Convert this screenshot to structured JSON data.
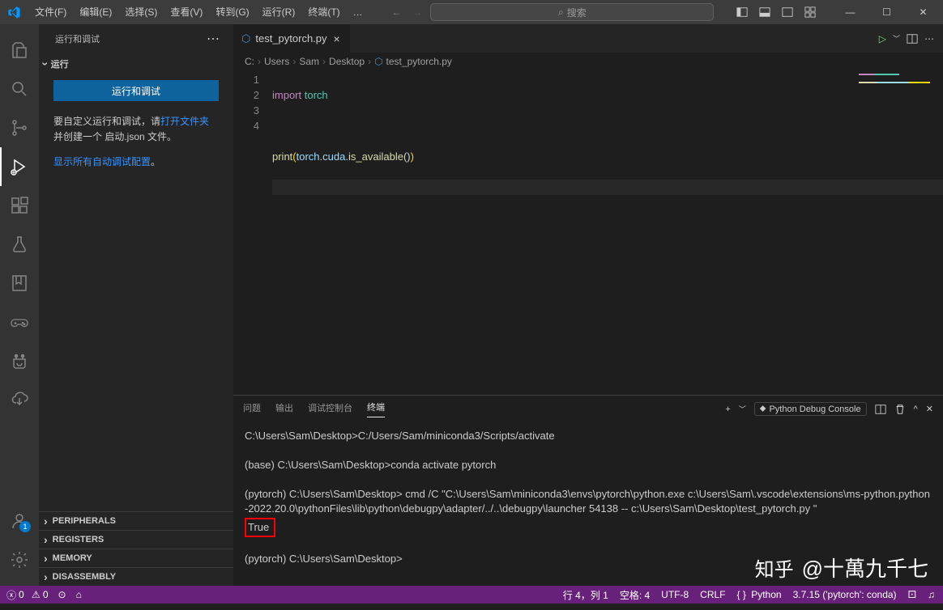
{
  "menu": {
    "file": "文件(F)",
    "edit": "编辑(E)",
    "select": "选择(S)",
    "view": "查看(V)",
    "go": "转到(G)",
    "run": "运行(R)",
    "terminal": "终端(T)",
    "more": "…"
  },
  "titlebar": {
    "search_placeholder": "搜索"
  },
  "sidebar": {
    "title": "运行和调试",
    "section_run": "运行",
    "run_debug_btn": "运行和调试",
    "hint_prefix": "要自定义运行和调试，请",
    "hint_link": "打开文件夹",
    "hint_suffix": " 并创建一个 启动.json 文件。",
    "show_configs_prefix": "显示所有自动调试配置",
    "show_configs_suffix": "。",
    "panels": {
      "peripherals": "PERIPHERALS",
      "registers": "REGISTERS",
      "memory": "MEMORY",
      "disassembly": "DISASSEMBLY"
    }
  },
  "tab": {
    "filename": "test_pytorch.py",
    "close": "×"
  },
  "breadcrumb": {
    "p0": "C:",
    "p1": "Users",
    "p2": "Sam",
    "p3": "Desktop",
    "p4": "test_pytorch.py"
  },
  "code": {
    "l1": {
      "kw": "import",
      "mod": " torch"
    },
    "l3_fn": "print",
    "l3_open": "(",
    "l3_var1": "torch",
    "l3_dot1": ".",
    "l3_var2": "cuda",
    "l3_dot2": ".",
    "l3_fn2": "is_available",
    "l3_par": "()",
    "l3_close": ")"
  },
  "lines": {
    "l1": "1",
    "l2": "2",
    "l3": "3",
    "l4": "4"
  },
  "panel": {
    "problems": "问题",
    "output": "输出",
    "debug_console": "调试控制台",
    "terminal": "终端",
    "py_debug": "Python Debug Console"
  },
  "terminal": {
    "l1": "C:\\Users\\Sam\\Desktop>C:/Users/Sam/miniconda3/Scripts/activate",
    "l2": "(base) C:\\Users\\Sam\\Desktop>conda activate pytorch",
    "l3": "(pytorch) C:\\Users\\Sam\\Desktop> cmd /C \"C:\\Users\\Sam\\miniconda3\\envs\\pytorch\\python.exe c:\\Users\\Sam\\.vscode\\extensions\\ms-python.python-2022.20.0\\pythonFiles\\lib\\python\\debugpy\\adapter/../..\\debugpy\\launcher 54138 -- c:\\Users\\Sam\\Desktop\\test_pytorch.py \"",
    "l4": "True",
    "l5": "(pytorch) C:\\Users\\Sam\\Desktop>"
  },
  "status": {
    "errors": "0",
    "warnings": "0",
    "line_col": "行 4，列 1",
    "spaces": "空格: 4",
    "encoding": "UTF-8",
    "eol": "CRLF",
    "lang": "Python",
    "interp": "3.7.15 ('pytorch': conda)"
  },
  "watermark": {
    "logo": "知乎",
    "author": "@十萬九千七"
  },
  "account_badge": "1"
}
